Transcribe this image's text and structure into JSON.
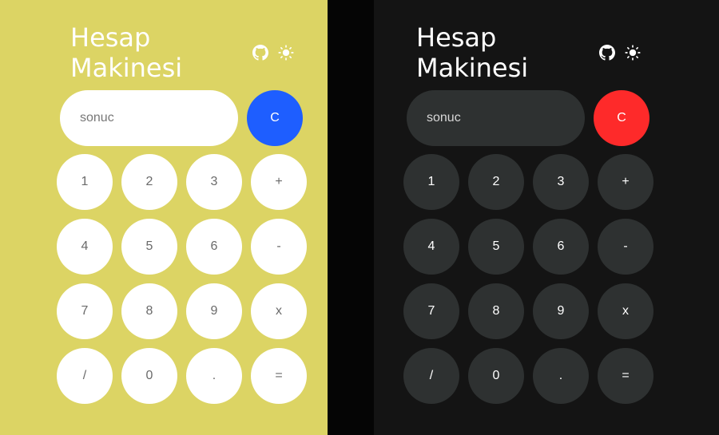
{
  "title_line1": "Hesap",
  "title_line2": "Makinesi",
  "display_value": "sonuc",
  "clear_label": "C",
  "keys": [
    "1",
    "2",
    "3",
    "+",
    "4",
    "5",
    "6",
    "-",
    "7",
    "8",
    "9",
    "x",
    "/",
    "0",
    ".",
    "="
  ],
  "icons": [
    "github-icon",
    "sun-icon"
  ],
  "themes": {
    "light": {
      "background": "#dcd464",
      "clear_color": "#1e5eff",
      "key_background": "#ffffff"
    },
    "dark": {
      "background": "#141414",
      "clear_color": "#fe2a2a",
      "key_background": "#2e3131"
    }
  }
}
